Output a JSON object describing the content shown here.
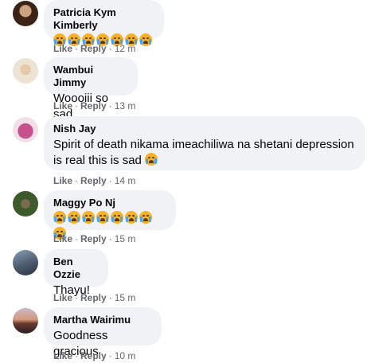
{
  "comments": [
    {
      "name": "Patricia Kym Kimberly",
      "text": "",
      "emoji_count": 7,
      "like": "Like",
      "reply": "Reply",
      "time": "12 m",
      "avatar_color": "#7a5a3b"
    },
    {
      "name": "Wambui Jimmy",
      "text": "Woooiii so sad",
      "emoji_count": 0,
      "like": "Like",
      "reply": "Reply",
      "time": "13 m",
      "avatar_color": "#d9c7a8"
    },
    {
      "name": "Nish Jay",
      "text": "Spirit of death nikama imeachiliwa na shetani depression is real this is sad",
      "emoji_count": 1,
      "like": "Like",
      "reply": "Reply",
      "time": "14 m",
      "avatar_color": "#c6508d"
    },
    {
      "name": "Maggy Po Nj",
      "text": "",
      "emoji_count": 8,
      "like": "Like",
      "reply": "Reply",
      "time": "15 m",
      "avatar_color": "#3d5a2c"
    },
    {
      "name": "Ben Ozzie",
      "text": "Thayu!",
      "emoji_count": 0,
      "like": "Like",
      "reply": "Reply",
      "time": "15 m",
      "avatar_color": "#4c5b6e"
    },
    {
      "name": "Martha Wairimu",
      "text": "Goodness gracious",
      "emoji_count": 0,
      "like": "Like",
      "reply": "Reply",
      "time": "10 m",
      "avatar_color": "#8a5a4a"
    }
  ],
  "separator": "·",
  "emoji_icon": "crying-face-icon"
}
